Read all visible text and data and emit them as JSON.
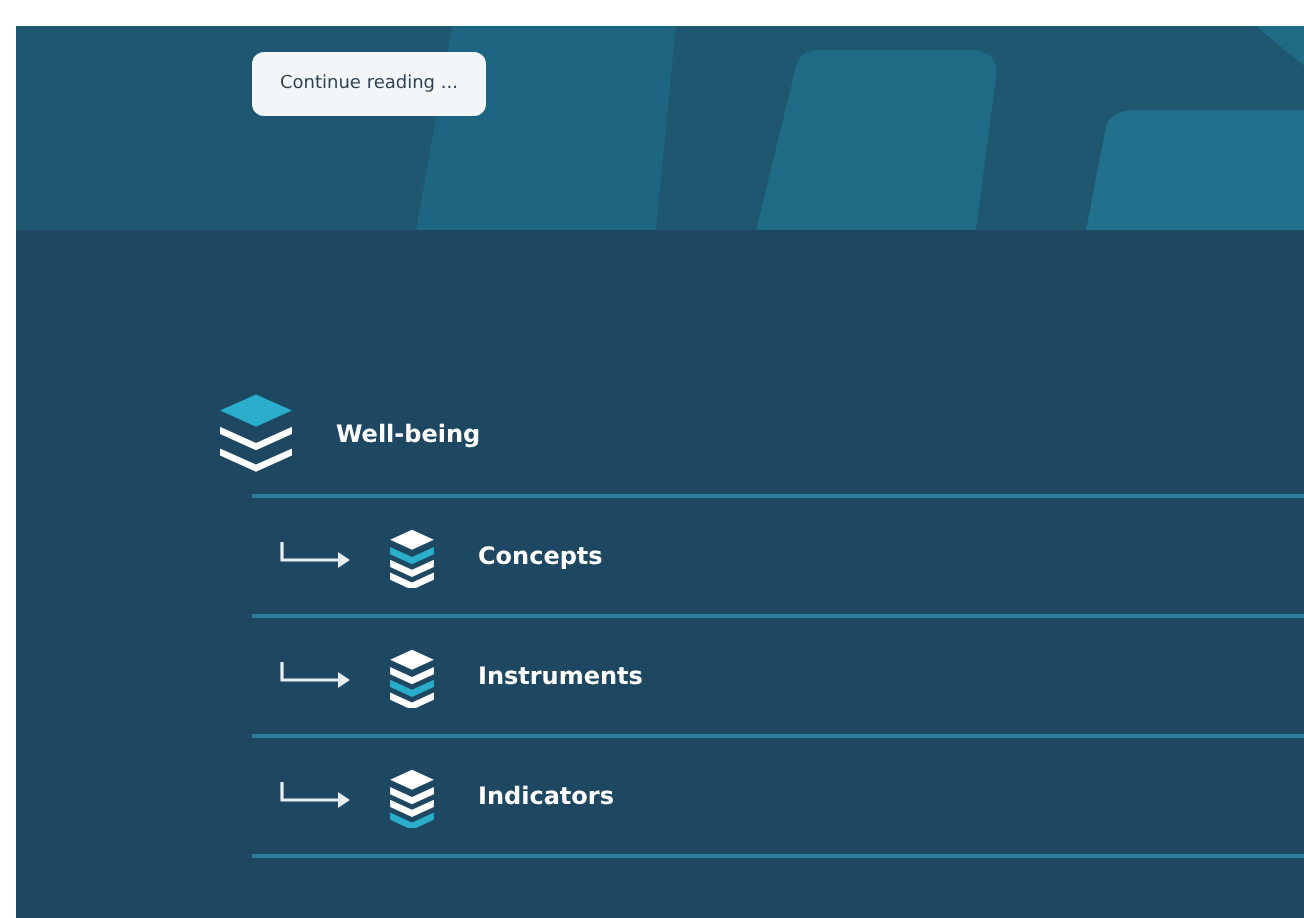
{
  "banner": {
    "button": "Continue reading ..."
  },
  "topic": {
    "label": "Well-being",
    "kind": "top",
    "children": [
      {
        "label": "Concepts",
        "kind": "second"
      },
      {
        "label": "Instruments",
        "kind": "third"
      },
      {
        "label": "Indicators",
        "kind": "bottom"
      }
    ]
  }
}
